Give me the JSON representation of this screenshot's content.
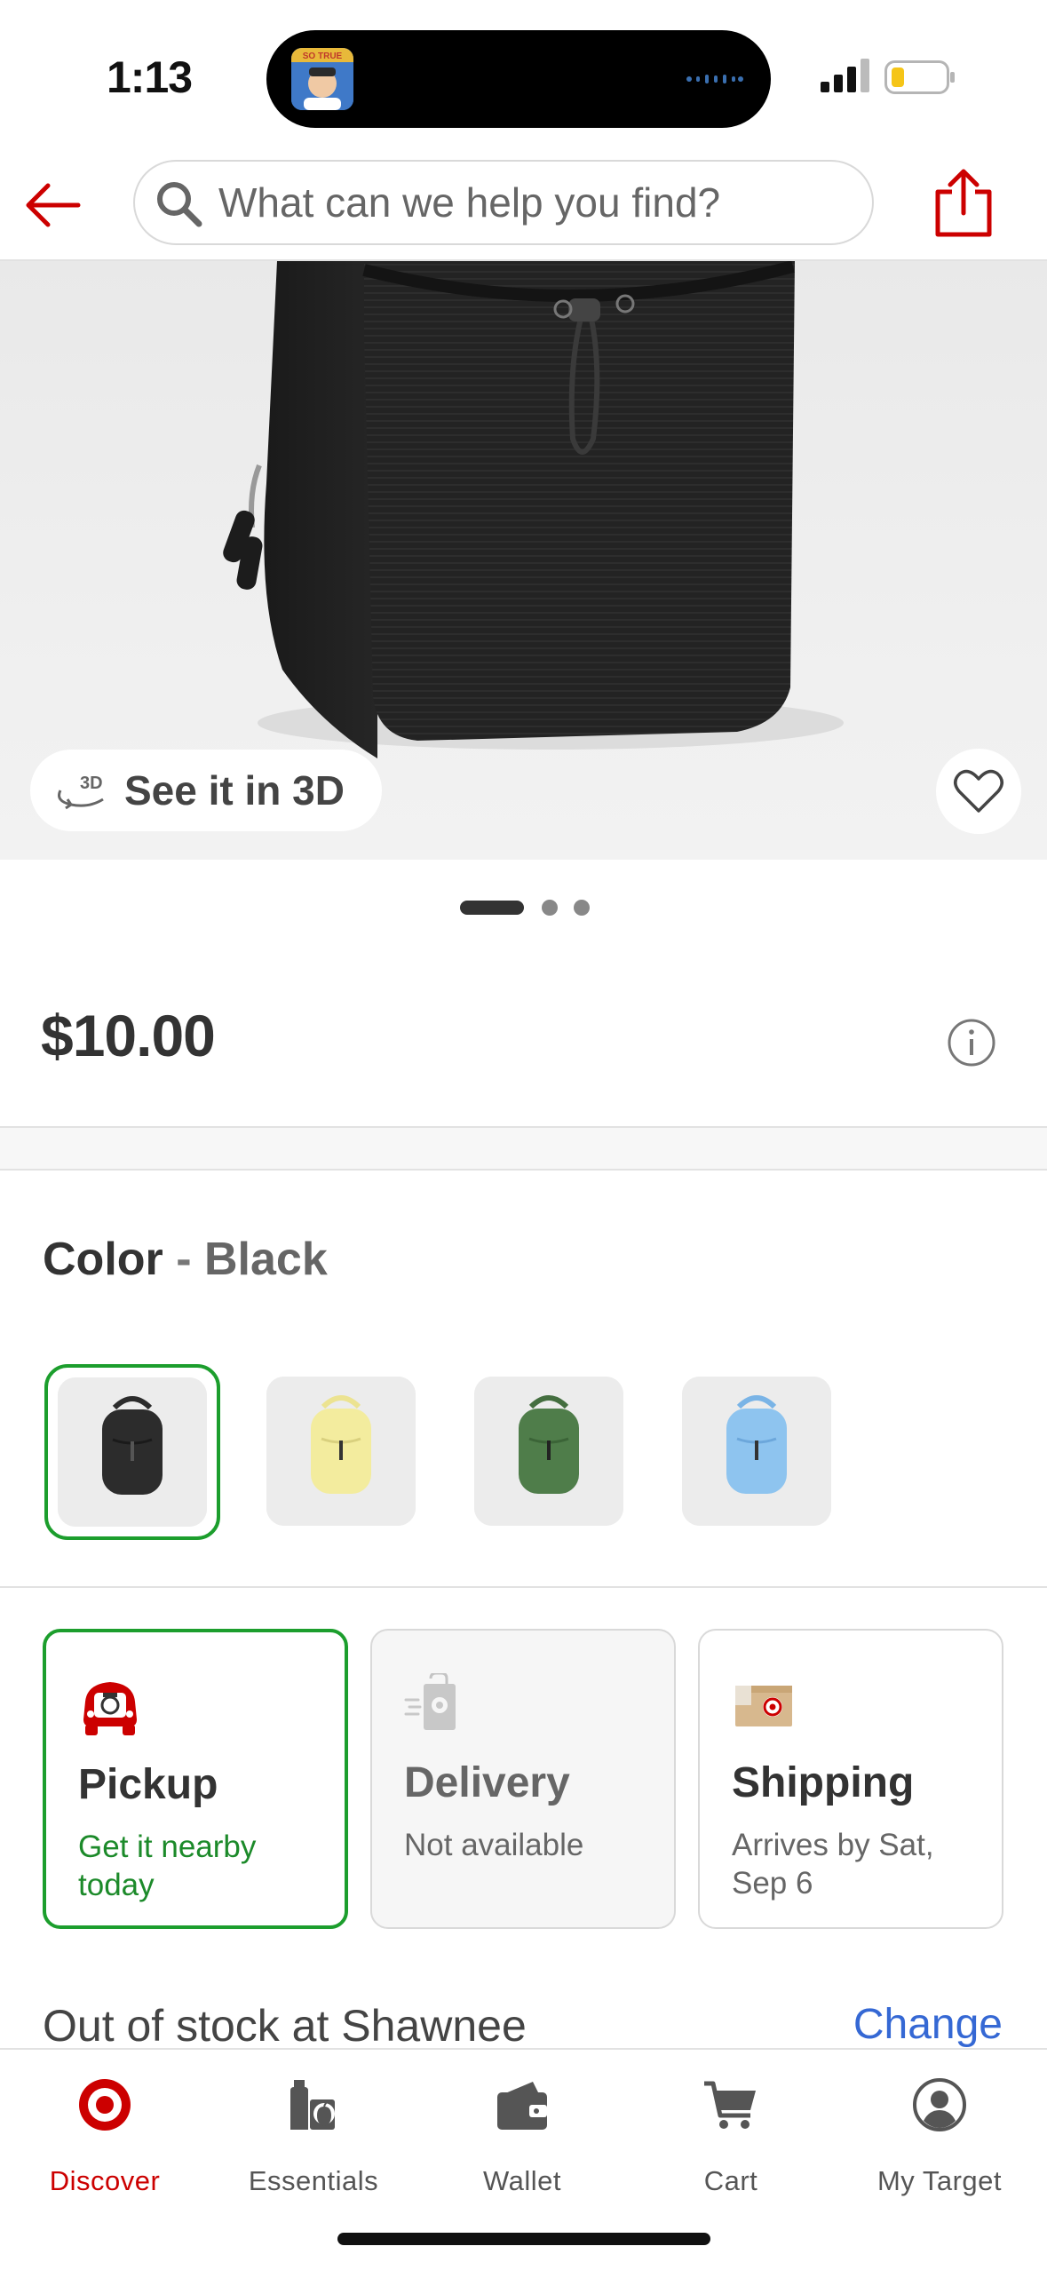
{
  "status_bar": {
    "time": "1:13",
    "island_app_label": "SO TRUE"
  },
  "header": {
    "search": {
      "placeholder": "What can we help you find?",
      "value": ""
    }
  },
  "gallery": {
    "see_3d_label": "See it in 3D",
    "see_3d_badge": "3D",
    "image_count": 3,
    "active_image": 1
  },
  "product": {
    "price": "$10.00"
  },
  "color": {
    "label": "Color",
    "separator": "-",
    "selected": "Black",
    "swatches": [
      {
        "name": "Black",
        "color": "#2c2c2c",
        "selected": true
      },
      {
        "name": "Yellow",
        "color": "#f3ec9e",
        "selected": false
      },
      {
        "name": "Green",
        "color": "#4f7d4a",
        "selected": false
      },
      {
        "name": "Blue",
        "color": "#8ec4ef",
        "selected": false
      }
    ]
  },
  "fulfillment": {
    "options": [
      {
        "title": "Pickup",
        "subtitle": "Get it nearby today",
        "state": "selected"
      },
      {
        "title": "Delivery",
        "subtitle": "Not available",
        "state": "disabled"
      },
      {
        "title": "Shipping",
        "subtitle": "Arrives by Sat, Sep 6",
        "state": "default"
      }
    ]
  },
  "stock": {
    "text": "Out of stock at Shawnee",
    "change_label": "Change"
  },
  "tab_bar": {
    "tabs": [
      {
        "label": "Discover",
        "icon": "bullseye-icon",
        "active": true
      },
      {
        "label": "Essentials",
        "icon": "essentials-icon",
        "active": false
      },
      {
        "label": "Wallet",
        "icon": "wallet-icon",
        "active": false
      },
      {
        "label": "Cart",
        "icon": "cart-icon",
        "active": false
      },
      {
        "label": "My Target",
        "icon": "account-icon",
        "active": false
      }
    ]
  },
  "colors": {
    "brand_red": "#cc0000",
    "selected_green": "#1c9e2d",
    "link_blue": "#3568d4"
  }
}
